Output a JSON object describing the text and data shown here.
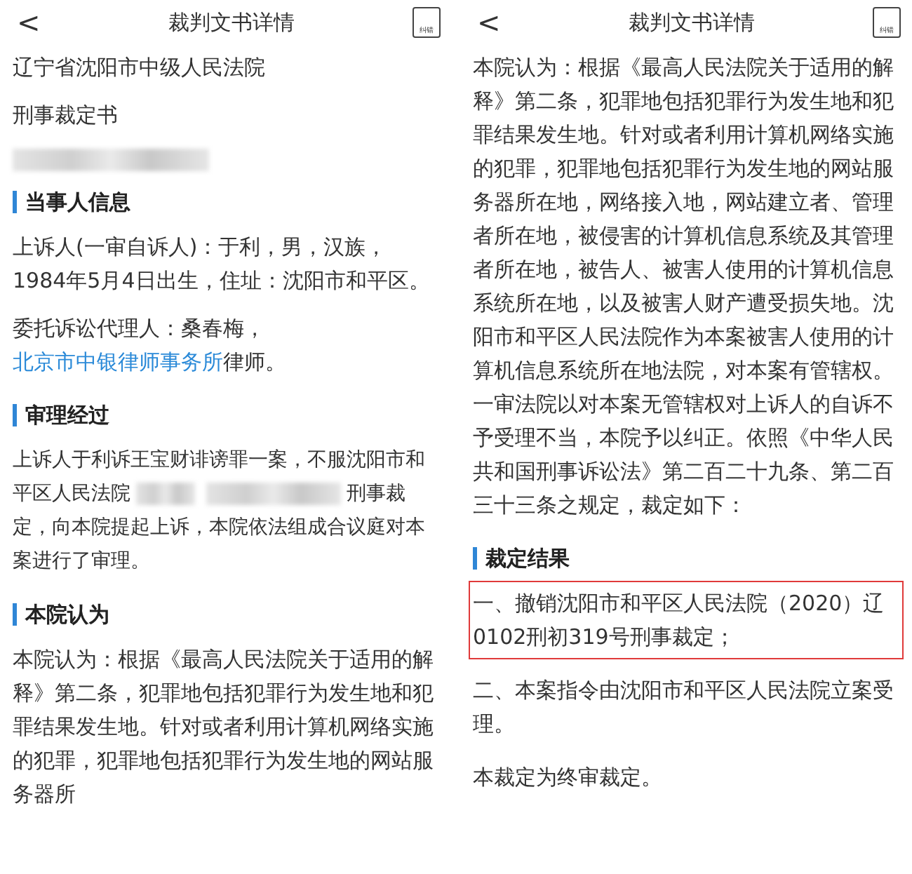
{
  "panels": [
    {
      "header": {
        "back": "<",
        "title": "裁判文书详情",
        "report_label": "纠错"
      },
      "blocks": [
        {
          "kind": "plain",
          "text": "辽宁省沈阳市中级人民法院"
        },
        {
          "kind": "plain",
          "text": "刑事裁定书"
        },
        {
          "kind": "redacted"
        },
        {
          "kind": "heading",
          "text": "当事人信息"
        },
        {
          "kind": "plain",
          "text": "上诉人(一审自诉人)：于利，男，汉族，1984年5月4日出生，住址：沈阳市和平区。"
        },
        {
          "kind": "rich",
          "segments": [
            {
              "kind": "text",
              "text": "委托诉讼代理人：桑春梅，"
            },
            {
              "kind": "link",
              "text": "北京市中银律师事务所"
            },
            {
              "kind": "text",
              "text": "律师。"
            }
          ]
        },
        {
          "kind": "heading",
          "text": "审理经过"
        },
        {
          "kind": "lines",
          "lines": [
            [
              {
                "kind": "text",
                "text": "上诉人于利诉王宝财诽谤罪一案，不服沈阳市和"
              }
            ],
            [
              {
                "kind": "text",
                "text": "平区人民法院"
              },
              {
                "kind": "redacted"
              },
              {
                "kind": "redacted"
              },
              {
                "kind": "text",
                "text": "刑事裁"
              }
            ],
            [
              {
                "kind": "text",
                "text": "定，向本院提起上诉，本院依法组成合议庭对本案进行了审理。"
              }
            ]
          ]
        },
        {
          "kind": "heading",
          "text": "本院认为"
        },
        {
          "kind": "plain",
          "text": "本院认为：根据《最高人民法院关于适用的解释》第二条，犯罪地包括犯罪行为发生地和犯罪结果发生地。针对或者利用计算机网络实施的犯罪，犯罪地包括犯罪行为发生地的网站服务器所"
        }
      ]
    },
    {
      "header": {
        "back": "<",
        "title": "裁判文书详情",
        "report_label": "纠错"
      },
      "blocks": [
        {
          "kind": "plain",
          "text": "本院认为：根据《最高人民法院关于适用的解释》第二条，犯罪地包括犯罪行为发生地和犯罪结果发生地。针对或者利用计算机网络实施的犯罪，犯罪地包括犯罪行为发生地的网站服务器所在地，网络接入地，网站建立者、管理者所在地，被侵害的计算机信息系统及其管理者所在地，被告人、被害人使用的计算机信息系统所在地，以及被害人财产遭受损失地。沈阳市和平区人民法院作为本案被害人使用的计算机信息系统所在地法院，对本案有管辖权。一审法院以对本案无管辖权对上诉人的自诉不予受理不当，本院予以纠正。依照《中华人民共和国刑事诉讼法》第二百二十九条、第二百三十三条之规定，裁定如下："
        },
        {
          "kind": "heading",
          "text": "裁定结果"
        },
        {
          "kind": "result",
          "highlighted": true,
          "text": "一、撤销沈阳市和平区人民法院（2020）辽0102刑初319号刑事裁定；"
        },
        {
          "kind": "result",
          "highlighted": false,
          "text": "二、本案指令由沈阳市和平区人民法院立案受理。"
        },
        {
          "kind": "plain",
          "text": "本裁定为终审裁定。"
        }
      ]
    }
  ]
}
